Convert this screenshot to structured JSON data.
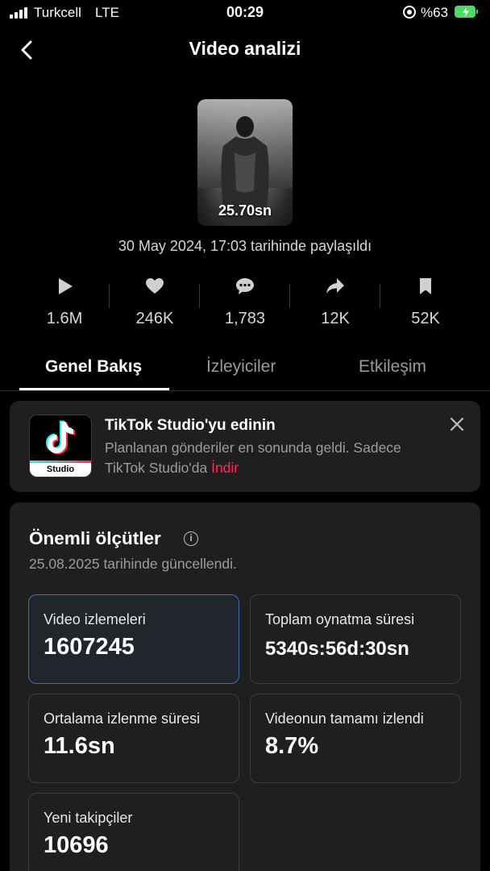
{
  "status_bar": {
    "carrier": "Turkcell",
    "network": "LTE",
    "time": "00:29",
    "battery": "%63"
  },
  "header": {
    "title": "Video analizi"
  },
  "video": {
    "duration": "25.70sn",
    "shared_text": "30 May 2024, 17:03 tarihinde paylaşıldı"
  },
  "stats": [
    {
      "icon": "play-icon",
      "value": "1.6M"
    },
    {
      "icon": "heart-icon",
      "value": "246K"
    },
    {
      "icon": "comment-icon",
      "value": "1,783"
    },
    {
      "icon": "share-icon",
      "value": "12K"
    },
    {
      "icon": "bookmark-icon",
      "value": "52K"
    }
  ],
  "tabs": [
    {
      "label": "Genel Bakış",
      "active": true
    },
    {
      "label": "İzleyiciler",
      "active": false
    },
    {
      "label": "Etkileşim",
      "active": false
    }
  ],
  "promo": {
    "logo_label": "Studio",
    "title": "TikTok Studio'yu edinin",
    "text": "Planlanan gönderiler en sonunda geldi. Sadece TikTok Studio'da",
    "link": "İndir"
  },
  "metrics": {
    "title": "Önemli ölçütler",
    "updated": "25.08.2025 tarihinde güncellendi.",
    "cards": [
      {
        "label": "Video izlemeleri",
        "value": "1607245"
      },
      {
        "label": "Toplam oynatma süresi",
        "value": "5340s:56d:30sn"
      },
      {
        "label": "Ortalama izlenme süresi",
        "value": "11.6sn"
      },
      {
        "label": "Videonun tamamı izlendi",
        "value": "8.7%"
      },
      {
        "label": "Yeni takipçiler",
        "value": "10696"
      }
    ]
  },
  "colors": {
    "accent": "#fe2c55",
    "selected_border": "#3e6fb4",
    "battery": "#4cd964",
    "panel": "#1f1f1f"
  }
}
